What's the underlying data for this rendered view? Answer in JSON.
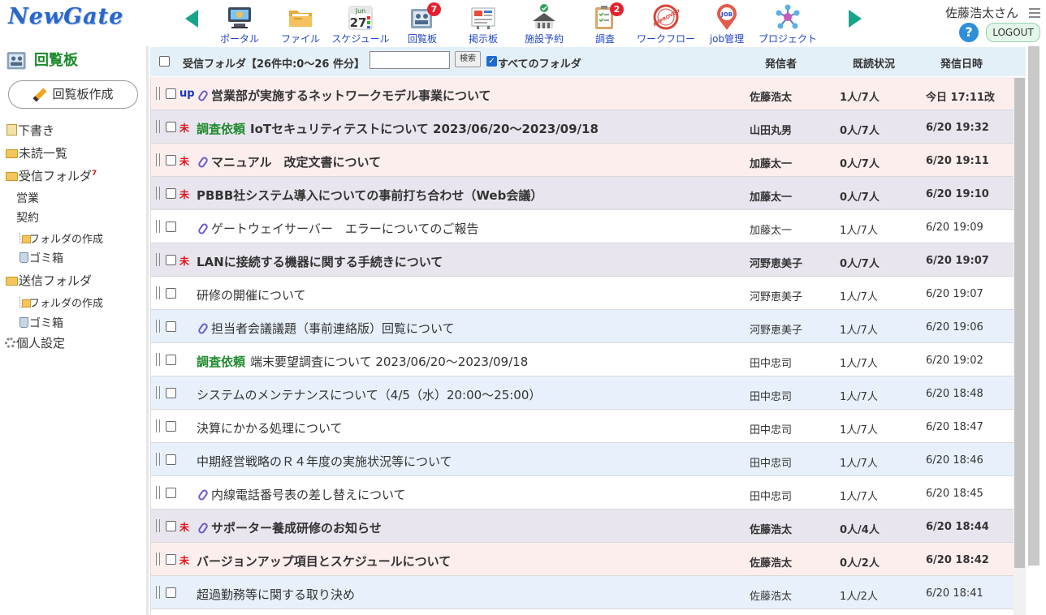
{
  "header": {
    "logo": "NewGate",
    "user_name": "佐藤浩太さん",
    "help": "?",
    "logout": "LOGOUT",
    "nav": [
      {
        "label": "ポータル",
        "icon": "portal-icon",
        "badge": ""
      },
      {
        "label": "ファイル",
        "icon": "folder-icon",
        "badge": ""
      },
      {
        "label": "スケジュール",
        "icon": "calendar-icon",
        "badge": "",
        "cal_month": "Jun",
        "cal_day": "27"
      },
      {
        "label": "回覧板",
        "icon": "circular-board-icon",
        "badge": "7"
      },
      {
        "label": "掲示板",
        "icon": "bulletin-board-icon",
        "badge": ""
      },
      {
        "label": "施設予約",
        "icon": "facility-icon",
        "badge": ""
      },
      {
        "label": "調査",
        "icon": "survey-icon",
        "badge": "2"
      },
      {
        "label": "ワークフロー",
        "icon": "approved-stamp-icon",
        "badge": "",
        "stamp": "APPROVED"
      },
      {
        "label": "job管理",
        "icon": "job-pin-icon",
        "badge": "",
        "pin": "JOB"
      },
      {
        "label": "プロジェクト",
        "icon": "project-network-icon",
        "badge": ""
      }
    ]
  },
  "sidebar": {
    "title": "回覧板",
    "create_button": "回覧板作成",
    "drafts": "下書き",
    "unread_list": "未読一覧",
    "inbox": "受信フォルダ",
    "inbox_count": "7",
    "inbox_sub": [
      "営業",
      "契約"
    ],
    "inbox_create_folder": "フォルダの作成",
    "inbox_trash": "ゴミ箱",
    "sent": "送信フォルダ",
    "sent_create_folder": "フォルダの作成",
    "sent_trash": "ゴミ箱",
    "settings": "個人設定"
  },
  "toolbar": {
    "folder_info": "受信フォルダ【26件中:0～26 件分】",
    "search_value": "",
    "search_button": "検索",
    "all_folders_label": "すべてのフォルダ",
    "all_folders_checked": true,
    "col_sender": "発信者",
    "col_read": "既読状況",
    "col_date": "発信日時"
  },
  "rows": [
    {
      "flag": "up",
      "clip": true,
      "tag": "",
      "subject": "営業部が実施するネットワークモデル事業について",
      "sender": "佐藤浩太",
      "read": "1人/7人",
      "date": "今日 17:11改",
      "bold": true,
      "bg": "pink"
    },
    {
      "flag": "未",
      "clip": false,
      "tag": "調査依頼",
      "subject": "IoTセキュリティテストについて 2023/06/20～2023/09/18",
      "sender": "山田丸男",
      "read": "0人/7人",
      "date": "6/20 19:32",
      "bold": true,
      "bg": "grey"
    },
    {
      "flag": "未",
      "clip": true,
      "tag": "",
      "subject": "マニュアル　改定文書について",
      "sender": "加藤太一",
      "read": "0人/7人",
      "date": "6/20 19:11",
      "bold": true,
      "bg": "pink"
    },
    {
      "flag": "未",
      "clip": false,
      "tag": "",
      "subject": "PBBB社システム導入についての事前打ち合わせ（Web会議）",
      "sender": "加藤太一",
      "read": "0人/7人",
      "date": "6/20 19:10",
      "bold": true,
      "bg": "grey"
    },
    {
      "flag": "",
      "clip": true,
      "tag": "",
      "subject": "ゲートウェイサーバー　エラーについてのご報告",
      "sender": "加藤太一",
      "read": "1人/7人",
      "date": "6/20 19:09",
      "bold": false,
      "bg": "white"
    },
    {
      "flag": "未",
      "clip": false,
      "tag": "",
      "subject": "LANに接続する機器に関する手続きについて",
      "sender": "河野恵美子",
      "read": "0人/7人",
      "date": "6/20 19:07",
      "bold": true,
      "bg": "grey"
    },
    {
      "flag": "",
      "clip": false,
      "tag": "",
      "subject": "研修の開催について",
      "sender": "河野恵美子",
      "read": "1人/7人",
      "date": "6/20 19:07",
      "bold": false,
      "bg": "white"
    },
    {
      "flag": "",
      "clip": true,
      "tag": "",
      "subject": "担当者会議議題（事前連絡版）回覧について",
      "sender": "河野恵美子",
      "read": "1人/7人",
      "date": "6/20 19:06",
      "bold": false,
      "bg": "blue"
    },
    {
      "flag": "",
      "clip": false,
      "tag": "調査依頼",
      "subject": "端末要望調査について 2023/06/20～2023/09/18",
      "sender": "田中忠司",
      "read": "1人/7人",
      "date": "6/20 19:02",
      "bold": false,
      "bg": "white"
    },
    {
      "flag": "",
      "clip": false,
      "tag": "",
      "subject": "システムのメンテナンスについて（4/5（水）20:00～25:00）",
      "sender": "田中忠司",
      "read": "1人/7人",
      "date": "6/20 18:48",
      "bold": false,
      "bg": "blue"
    },
    {
      "flag": "",
      "clip": false,
      "tag": "",
      "subject": "決算にかかる処理について",
      "sender": "田中忠司",
      "read": "1人/7人",
      "date": "6/20 18:47",
      "bold": false,
      "bg": "white"
    },
    {
      "flag": "",
      "clip": false,
      "tag": "",
      "subject": "中期経営戦略のＲ４年度の実施状況等について",
      "sender": "田中忠司",
      "read": "1人/7人",
      "date": "6/20 18:46",
      "bold": false,
      "bg": "blue"
    },
    {
      "flag": "",
      "clip": true,
      "tag": "",
      "subject": "内線電話番号表の差し替えについて",
      "sender": "田中忠司",
      "read": "1人/7人",
      "date": "6/20 18:45",
      "bold": false,
      "bg": "white"
    },
    {
      "flag": "未",
      "clip": true,
      "tag": "",
      "subject": "サポーター養成研修のお知らせ",
      "sender": "佐藤浩太",
      "read": "0人/4人",
      "date": "6/20 18:44",
      "bold": true,
      "bg": "grey"
    },
    {
      "flag": "未",
      "clip": false,
      "tag": "",
      "subject": "バージョンアップ項目とスケジュールについて",
      "sender": "佐藤浩太",
      "read": "0人/2人",
      "date": "6/20 18:42",
      "bold": true,
      "bg": "pink"
    },
    {
      "flag": "",
      "clip": false,
      "tag": "",
      "subject": "超過勤務等に関する取り決め",
      "sender": "佐藤浩太",
      "read": "1人/2人",
      "date": "6/20 18:41",
      "bold": false,
      "bg": "blue"
    }
  ]
}
